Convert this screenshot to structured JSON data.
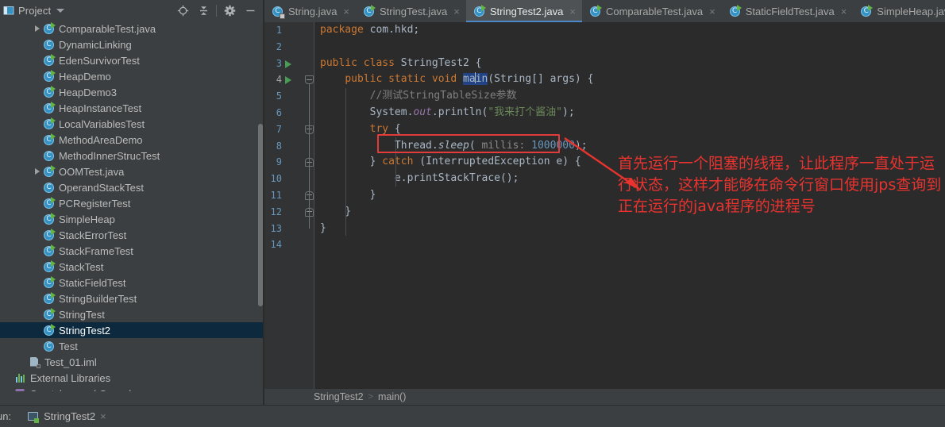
{
  "project_panel": {
    "title": "Project",
    "icons": {
      "window_icon": "project-window-icon",
      "dropdown": "chevron-down-icon",
      "locate": "locate-target-icon",
      "collapse_all": "collapse-all-icon",
      "settings": "gear-icon",
      "hide": "minimize-icon"
    },
    "tree": [
      {
        "label": "ComparableTest.java",
        "indent": 2,
        "arrow": "collapsed",
        "icon": "java-class-icon",
        "runnable": true,
        "selected": false
      },
      {
        "label": "DynamicLinking",
        "indent": 2,
        "arrow": "none",
        "icon": "java-class-icon",
        "runnable": false,
        "selected": false
      },
      {
        "label": "EdenSurvivorTest",
        "indent": 2,
        "arrow": "none",
        "icon": "java-class-icon",
        "runnable": true,
        "selected": false
      },
      {
        "label": "HeapDemo",
        "indent": 2,
        "arrow": "none",
        "icon": "java-class-icon",
        "runnable": true,
        "selected": false
      },
      {
        "label": "HeapDemo3",
        "indent": 2,
        "arrow": "none",
        "icon": "java-class-icon",
        "runnable": true,
        "selected": false
      },
      {
        "label": "HeapInstanceTest",
        "indent": 2,
        "arrow": "none",
        "icon": "java-class-icon",
        "runnable": true,
        "selected": false
      },
      {
        "label": "LocalVariablesTest",
        "indent": 2,
        "arrow": "none",
        "icon": "java-class-icon",
        "runnable": true,
        "selected": false
      },
      {
        "label": "MethodAreaDemo",
        "indent": 2,
        "arrow": "none",
        "icon": "java-class-icon",
        "runnable": true,
        "selected": false
      },
      {
        "label": "MethodInnerStrucTest",
        "indent": 2,
        "arrow": "none",
        "icon": "java-class-icon",
        "runnable": false,
        "selected": false
      },
      {
        "label": "OOMTest.java",
        "indent": 2,
        "arrow": "collapsed",
        "icon": "java-class-icon",
        "runnable": true,
        "selected": false
      },
      {
        "label": "OperandStackTest",
        "indent": 2,
        "arrow": "none",
        "icon": "java-class-icon",
        "runnable": false,
        "selected": false
      },
      {
        "label": "PCRegisterTest",
        "indent": 2,
        "arrow": "none",
        "icon": "java-class-icon",
        "runnable": true,
        "selected": false
      },
      {
        "label": "SimpleHeap",
        "indent": 2,
        "arrow": "none",
        "icon": "java-class-icon",
        "runnable": true,
        "selected": false
      },
      {
        "label": "StackErrorTest",
        "indent": 2,
        "arrow": "none",
        "icon": "java-class-icon",
        "runnable": true,
        "selected": false
      },
      {
        "label": "StackFrameTest",
        "indent": 2,
        "arrow": "none",
        "icon": "java-class-icon",
        "runnable": true,
        "selected": false
      },
      {
        "label": "StackTest",
        "indent": 2,
        "arrow": "none",
        "icon": "java-class-icon",
        "runnable": true,
        "selected": false
      },
      {
        "label": "StaticFieldTest",
        "indent": 2,
        "arrow": "none",
        "icon": "java-class-icon",
        "runnable": true,
        "selected": false
      },
      {
        "label": "StringBuilderTest",
        "indent": 2,
        "arrow": "none",
        "icon": "java-class-icon",
        "runnable": true,
        "selected": false
      },
      {
        "label": "StringTest",
        "indent": 2,
        "arrow": "none",
        "icon": "java-class-icon",
        "runnable": true,
        "selected": false
      },
      {
        "label": "StringTest2",
        "indent": 2,
        "arrow": "none",
        "icon": "java-class-icon",
        "runnable": true,
        "selected": true
      },
      {
        "label": "Test",
        "indent": 2,
        "arrow": "none",
        "icon": "java-class-icon",
        "runnable": false,
        "selected": false
      },
      {
        "label": "Test_01.iml",
        "indent": 1,
        "arrow": "none",
        "icon": "iml-module-icon",
        "runnable": false,
        "selected": false
      },
      {
        "label": "External Libraries",
        "indent": 0,
        "arrow": "none",
        "icon": "external-libraries-icon",
        "runnable": false,
        "selected": false
      },
      {
        "label": "Scratches and Consoles",
        "indent": 0,
        "arrow": "none",
        "icon": "scratches-icon",
        "runnable": false,
        "selected": false
      }
    ]
  },
  "tabs": [
    {
      "label": "String.java",
      "active": false,
      "icon": "java-class-readonly-icon",
      "runnable": false,
      "locked": true,
      "close": "×"
    },
    {
      "label": "StringTest.java",
      "active": false,
      "icon": "java-class-icon",
      "runnable": true,
      "locked": false,
      "close": "×"
    },
    {
      "label": "StringTest2.java",
      "active": true,
      "icon": "java-class-icon",
      "runnable": true,
      "locked": false,
      "close": "×"
    },
    {
      "label": "ComparableTest.java",
      "active": false,
      "icon": "java-class-icon",
      "runnable": true,
      "locked": false,
      "close": "×"
    },
    {
      "label": "StaticFieldTest.java",
      "active": false,
      "icon": "java-class-icon",
      "runnable": true,
      "locked": false,
      "close": "×"
    },
    {
      "label": "SimpleHeap.java",
      "active": false,
      "icon": "java-class-icon",
      "runnable": true,
      "locked": false,
      "close": "×"
    }
  ],
  "editor": {
    "line_numbers": [
      "1",
      "2",
      "3",
      "4",
      "5",
      "6",
      "7",
      "8",
      "9",
      "10",
      "11",
      "12",
      "13",
      "14"
    ],
    "current_line": "4",
    "run_gutter_lines": [
      "3",
      "4"
    ],
    "code_lines": [
      {
        "n": "1",
        "text": "package com.hkd;"
      },
      {
        "n": "2",
        "text": ""
      },
      {
        "n": "3",
        "text": "public class StringTest2 {"
      },
      {
        "n": "4",
        "text": "    public static void main(String[] args) {"
      },
      {
        "n": "5",
        "text": "        //测试StringTableSize参数"
      },
      {
        "n": "6",
        "text": "        System.out.println(\"我来打个酱油\");"
      },
      {
        "n": "7",
        "text": "        try {"
      },
      {
        "n": "8",
        "text": "            Thread.sleep( millis: 1000000);"
      },
      {
        "n": "9",
        "text": "        } catch (InterruptedException e) {"
      },
      {
        "n": "10",
        "text": "            e.printStackTrace();"
      },
      {
        "n": "11",
        "text": "        }"
      },
      {
        "n": "12",
        "text": "    }"
      },
      {
        "n": "13",
        "text": "}"
      },
      {
        "n": "14",
        "text": ""
      }
    ],
    "selection": "main",
    "param_hint": "millis:",
    "sleep_arg": "1000000",
    "breadcrumb": {
      "class": "StringTest2",
      "separator": ">",
      "method": "main()"
    }
  },
  "annotation": {
    "note": "首先运行一个阻塞的线程，让此程序一直处于运行状态，这样才能够在命令行窗口使用jps查询到正在运行的java程序的进程号",
    "color": "#e8332f",
    "box_color": "#e23b3b",
    "arrow": "red-arrow-icon"
  },
  "bottom": {
    "run_label": "un:",
    "run_config": "StringTest2",
    "close": "×",
    "icon": "run-configuration-icon"
  },
  "colors": {
    "background": "#3c3f41",
    "editor_bg": "#2b2b2b",
    "gutter_bg": "#313335",
    "selection_bg": "#0d293e",
    "tab_active_bg": "#4e5254",
    "tab_underline": "#4a88c7",
    "keyword": "#cc7832",
    "string": "#6a8759",
    "comment": "#808080",
    "number": "#6897bb",
    "field": "#9876aa",
    "text": "#a9b7c6"
  }
}
